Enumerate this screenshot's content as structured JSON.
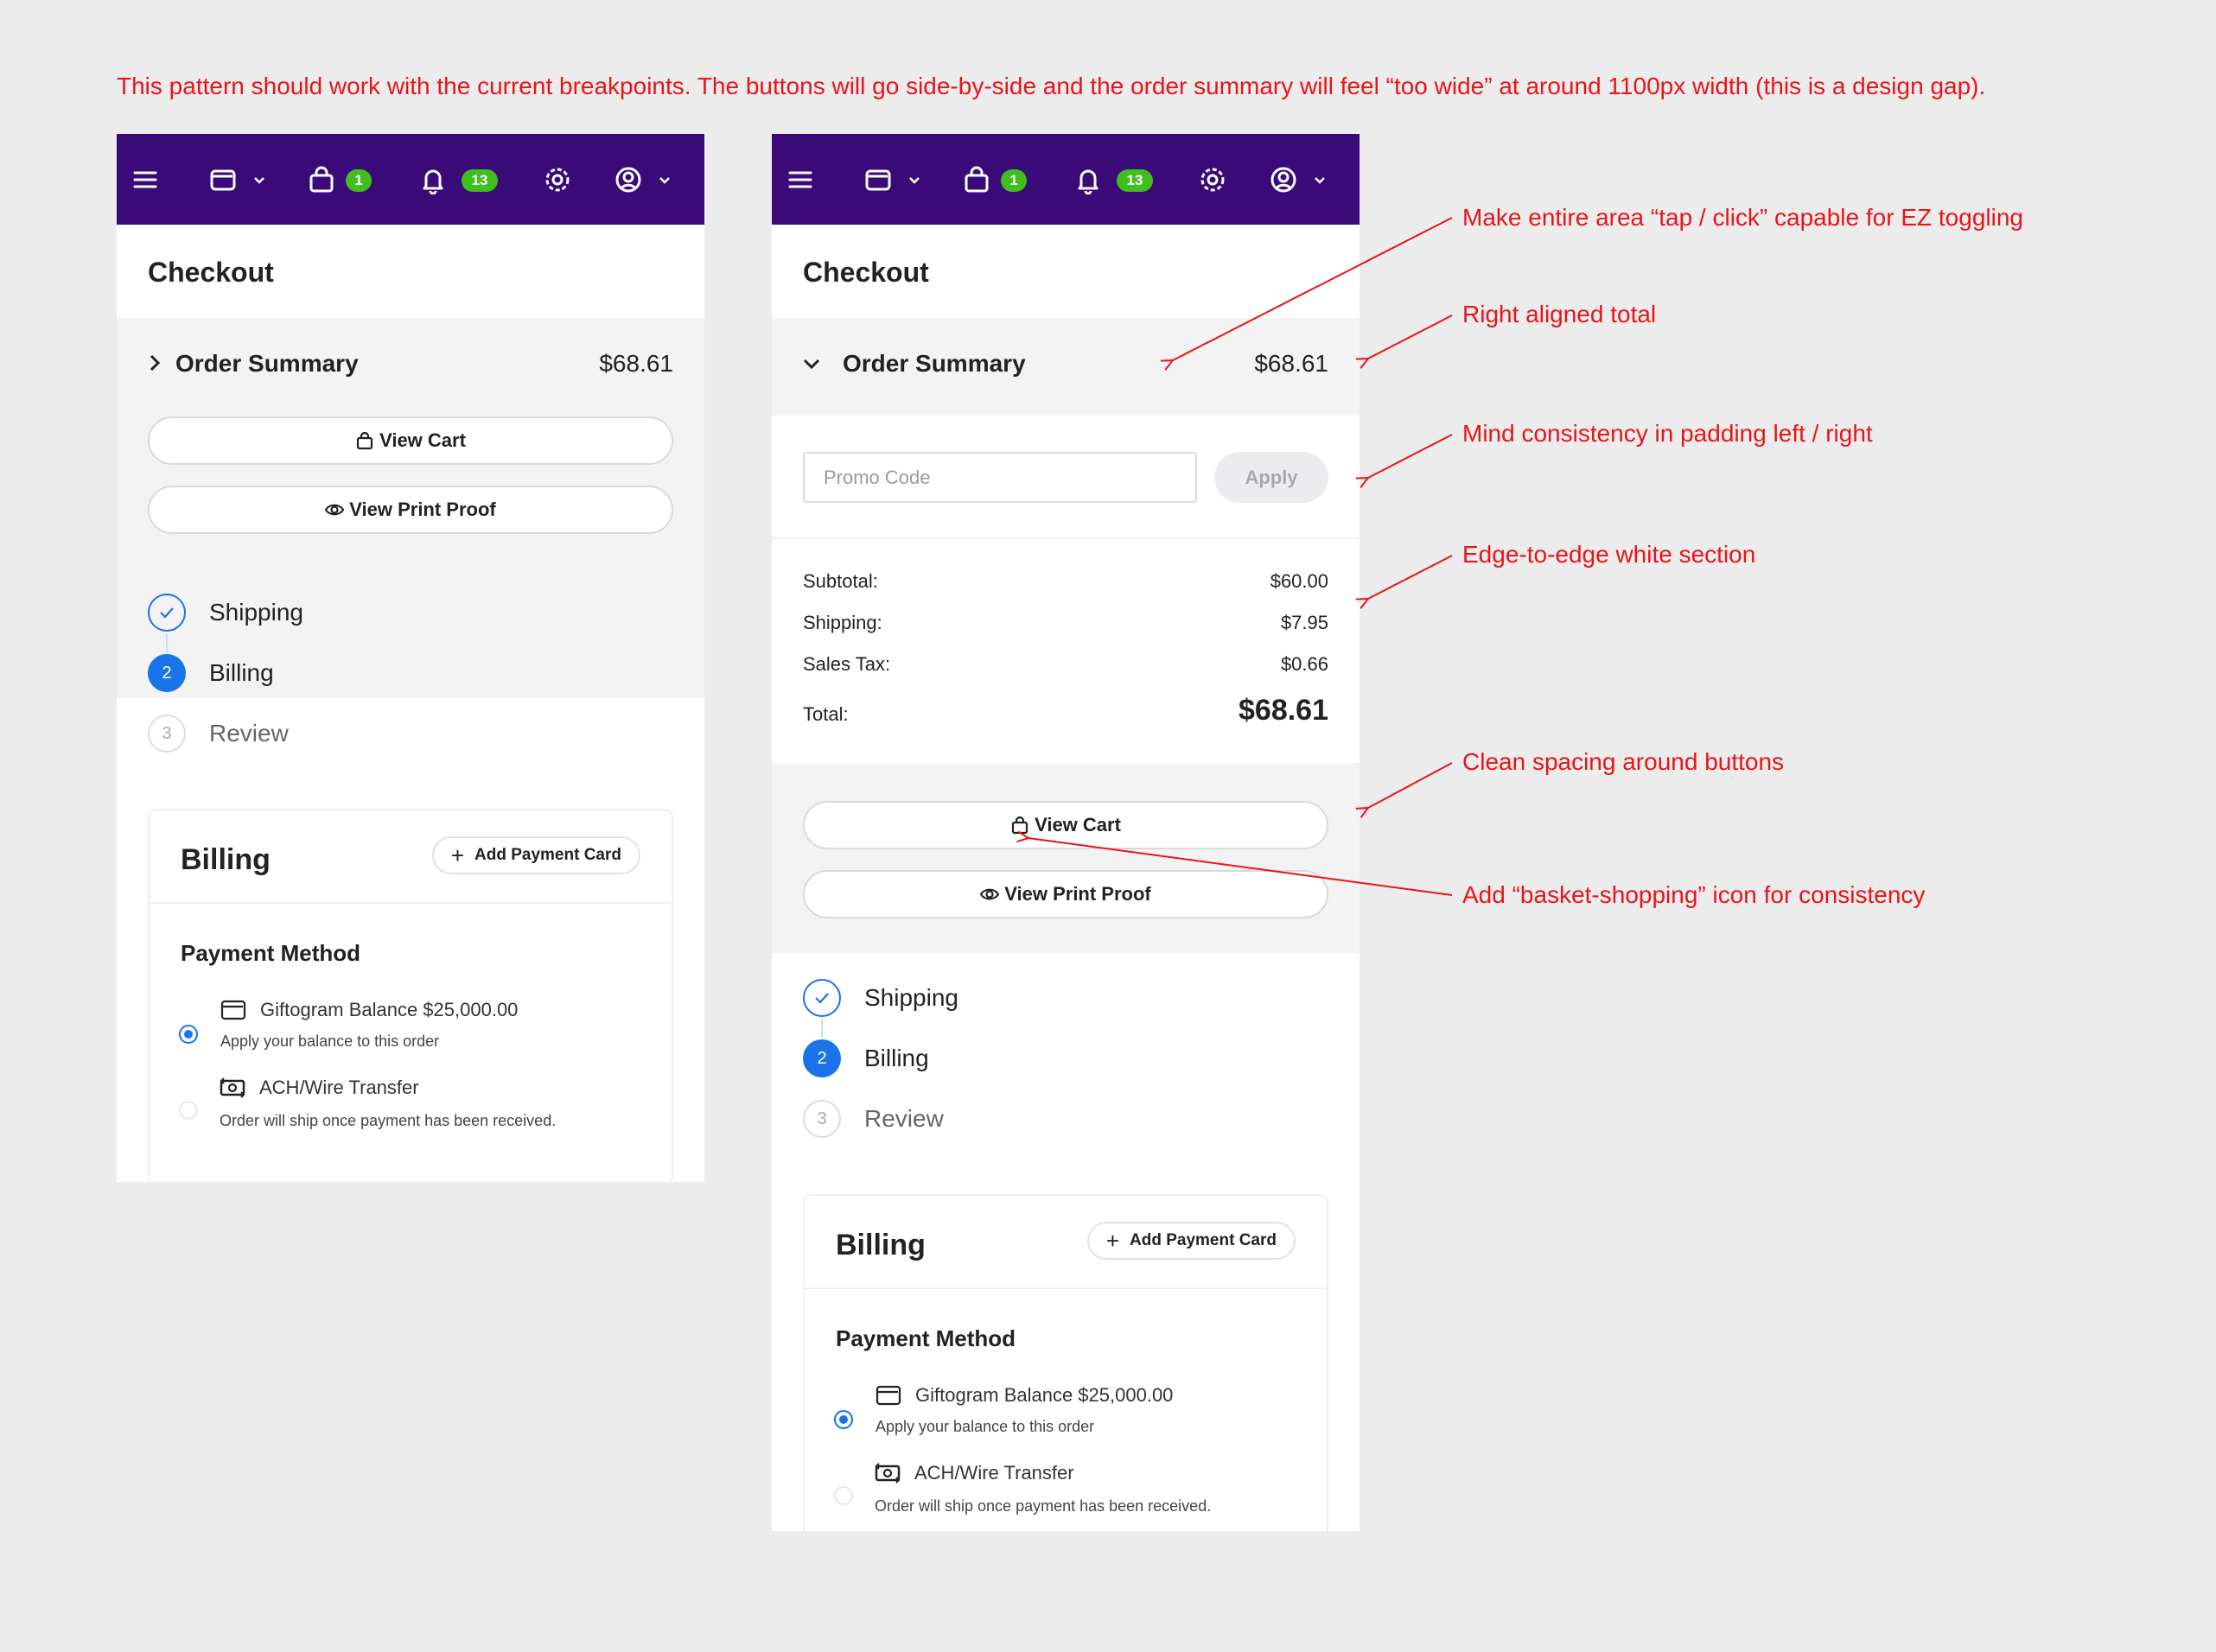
{
  "note": "This pattern should work with the current breakpoints. The buttons will go side-by-side and the order summary will feel “too wide” at around 1100px width (this is a design gap).",
  "nav": {
    "cart_badge": "1",
    "notification_badge": "13",
    "bg_color": "#3a0a78",
    "badge_color": "#3fbf1d",
    "icons": [
      "menu-icon",
      "wallet-icon",
      "shopping-bag-icon",
      "bell-icon",
      "gear-icon",
      "user-circle-icon"
    ]
  },
  "checkout": {
    "title": "Checkout",
    "order_summary_label": "Order Summary",
    "order_total": "$68.61",
    "view_cart_label": "View Cart",
    "view_print_proof_label": "View Print Proof",
    "promo_placeholder": "Promo Code",
    "apply_label": "Apply",
    "subtotal_label": "Subtotal:",
    "subtotal_value": "$60.00",
    "shipping_label": "Shipping:",
    "shipping_value": "$7.95",
    "tax_label": "Sales Tax:",
    "tax_value": "$0.66",
    "total_label": "Total:",
    "total_value": "$68.61"
  },
  "steps": [
    {
      "label": "Shipping",
      "state": "done"
    },
    {
      "label": "Billing",
      "number": "2",
      "state": "active"
    },
    {
      "label": "Review",
      "number": "3",
      "state": "pending"
    }
  ],
  "billing": {
    "title": "Billing",
    "add_card_label": "Add Payment Card",
    "payment_method_label": "Payment Method",
    "options": [
      {
        "name": "Giftogram Balance $25,000.00",
        "desc": "Apply your balance to this order",
        "selected": true
      },
      {
        "name": "ACH/Wire Transfer",
        "desc": "Order will ship once payment has been received.",
        "selected": false
      }
    ]
  },
  "annotations": {
    "tap_click": "Make entire area “tap / click” capable for EZ toggling",
    "right_aligned": "Right aligned total",
    "padding": "Mind consistency in padding left / right",
    "edge_to_edge": "Edge-to-edge white section",
    "clean_spacing": "Clean spacing around buttons",
    "basket_icon": "Add “basket-shopping” icon for consistency"
  },
  "colors": {
    "accent_blue": "#1a73e8",
    "annotation_red": "#e8141b",
    "summary_bg": "#f3f3f4"
  }
}
